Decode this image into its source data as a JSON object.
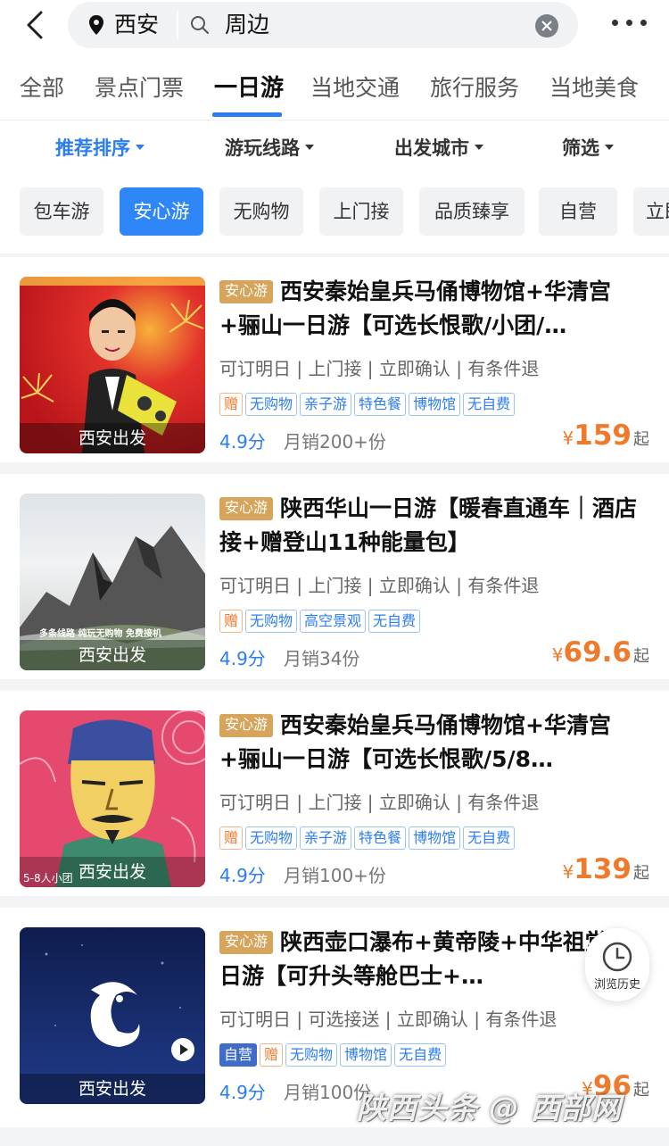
{
  "search": {
    "city": "西安",
    "query": "周边"
  },
  "tabs": [
    {
      "label": "全部"
    },
    {
      "label": "景点门票"
    },
    {
      "label": "一日游",
      "active": true
    },
    {
      "label": "当地交通"
    },
    {
      "label": "旅行服务"
    },
    {
      "label": "当地美食"
    }
  ],
  "sort": [
    {
      "label": "推荐排序",
      "active": true
    },
    {
      "label": "游玩线路"
    },
    {
      "label": "出发城市"
    },
    {
      "label": "筛选"
    }
  ],
  "chips": [
    {
      "label": "包车游"
    },
    {
      "label": "安心游",
      "active": true
    },
    {
      "label": "无购物"
    },
    {
      "label": "上门接"
    },
    {
      "label": "品质臻享"
    },
    {
      "label": "自营"
    },
    {
      "label": "立即"
    }
  ],
  "products": [
    {
      "badge": "安心游",
      "title": "西安秦始皇兵马俑博物馆+华清宫+骊山一日游【可选长恨歌/小团/…",
      "features": "可订明日 | 上门接 | 立即确认 | 有条件退",
      "tags": [
        "赠",
        "无购物",
        "亲子游",
        "特色餐",
        "博物馆",
        "无自费"
      ],
      "score": "4.9分",
      "sales": "月销200+份",
      "currency": "¥",
      "price": "159",
      "price_suffix": "起",
      "thumb_label": "西安出发"
    },
    {
      "badge": "安心游",
      "title": "陕西华山一日游【暖春直通车｜酒店接+赠登山11种能量包】",
      "features": "可订明日 | 上门接 | 立即确认 | 有条件退",
      "tags": [
        "赠",
        "无购物",
        "高空景观",
        "无自费"
      ],
      "score": "4.9分",
      "sales": "月销34份",
      "currency": "¥",
      "price": "69.6",
      "price_suffix": "起",
      "thumb_label": "西安出发",
      "thumb_caption": "多条线路  纯玩无购物  免费接机"
    },
    {
      "badge": "安心游",
      "title": "西安秦始皇兵马俑博物馆+华清宫+骊山一日游【可选长恨歌/5/8…",
      "features": "可订明日 | 上门接 | 立即确认 | 有条件退",
      "tags": [
        "赠",
        "无购物",
        "亲子游",
        "特色餐",
        "博物馆",
        "无自费"
      ],
      "score": "4.9分",
      "sales": "月销100+份",
      "currency": "¥",
      "price": "139",
      "price_suffix": "起",
      "thumb_label": "西安出发",
      "thumb_caption": "5-8人小团"
    },
    {
      "badge": "安心游",
      "title": "陕西壶口瀑布+黄帝陵+中华祖堂一日游【可升头等舱巴士+…",
      "features": "可订明日 | 可选接送 | 立即确认 | 有条件退",
      "tags": [
        "自营",
        "赠",
        "无购物",
        "博物馆",
        "无自费"
      ],
      "score": "4.9分",
      "sales": "月销100份",
      "currency": "¥",
      "price": "96",
      "price_suffix": "起",
      "thumb_label": "西安出发"
    }
  ],
  "history_label": "浏览历史",
  "watermark": "陕西头条 @ 西部网",
  "colors": {
    "accent": "#2b7df0",
    "price": "#f07a2c",
    "badge": "#d6a45a"
  }
}
